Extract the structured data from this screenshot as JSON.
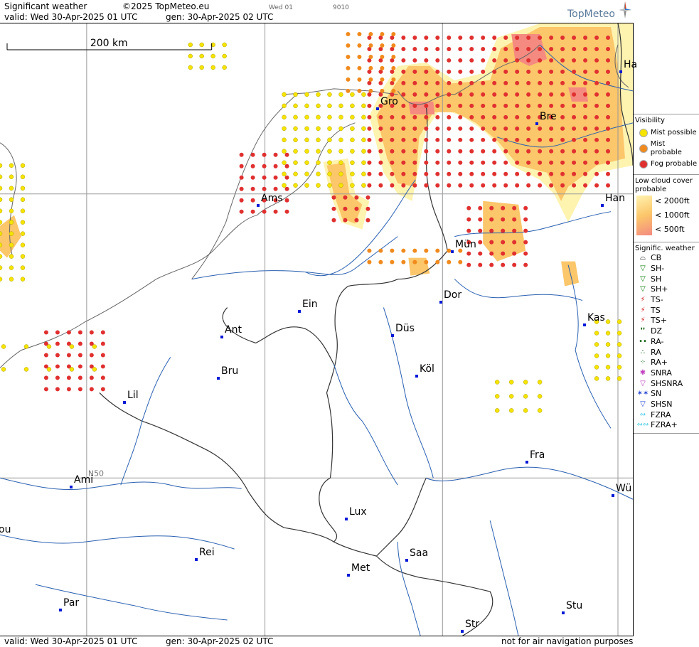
{
  "header": {
    "title": "Significant weather",
    "copyright": "©2025 TopMeteo.eu",
    "valid": "valid:  Wed  30-Apr-2025  01 UTC",
    "generated": "gen:  30-Apr-2025  02 UTC",
    "small_day": "Wed 01",
    "small_code": "9010",
    "brand": "TopMeteo"
  },
  "map": {
    "scale_label": "200 km",
    "grid_label": "N50",
    "cities": [
      {
        "label": "Gro"
      },
      {
        "label": "Bre"
      },
      {
        "label": "Ha"
      },
      {
        "label": "Ams"
      },
      {
        "label": "Han"
      },
      {
        "label": "Mün"
      },
      {
        "label": "Dor"
      },
      {
        "label": "Ein"
      },
      {
        "label": "Ant"
      },
      {
        "label": "Düs"
      },
      {
        "label": "Kas"
      },
      {
        "label": "Bru"
      },
      {
        "label": "Köl"
      },
      {
        "label": "Lil"
      },
      {
        "label": "Fra"
      },
      {
        "label": "Ami"
      },
      {
        "label": "Wü"
      },
      {
        "label": "Lux"
      },
      {
        "label": "ou"
      },
      {
        "label": "Rei"
      },
      {
        "label": "Saa"
      },
      {
        "label": "Met"
      },
      {
        "label": "Par"
      },
      {
        "label": "Stu"
      },
      {
        "label": "Str"
      }
    ]
  },
  "legend": {
    "visibility_title": "Visibility",
    "visibility": [
      {
        "label": "Mist possible",
        "color": "#f5e400"
      },
      {
        "label": "Mist probable",
        "color": "#f08a1c"
      },
      {
        "label": "Fog probable",
        "color": "#e03030"
      }
    ],
    "cloud_title": "Low cloud cover probable",
    "cloud": [
      {
        "label": "< 2000ft",
        "color": "#fff3b0"
      },
      {
        "label": "< 1000ft",
        "color": "#fcc66a"
      },
      {
        "label": "<   500ft",
        "color": "#f48a80"
      }
    ],
    "wx_title": "Signific. weather",
    "wx": [
      {
        "label": "CB",
        "icon": "cb-icon",
        "color": "#000000"
      },
      {
        "label": "SH-",
        "icon": "shower-light-icon",
        "color": "#0a7a0a"
      },
      {
        "label": "SH",
        "icon": "shower-icon",
        "color": "#0a7a0a"
      },
      {
        "label": "SH+",
        "icon": "shower-heavy-icon",
        "color": "#0a7a0a"
      },
      {
        "label": "TS-",
        "icon": "thunder-light-icon",
        "color": "#d02020"
      },
      {
        "label": "TS",
        "icon": "thunder-icon",
        "color": "#d02020"
      },
      {
        "label": "TS+",
        "icon": "thunder-heavy-icon",
        "color": "#d02020"
      },
      {
        "label": "DZ",
        "icon": "drizzle-icon",
        "color": "#0a5a0a"
      },
      {
        "label": "RA-",
        "icon": "rain-light-icon",
        "color": "#0a5a0a"
      },
      {
        "label": "RA",
        "icon": "rain-icon",
        "color": "#0a5a0a"
      },
      {
        "label": "RA+",
        "icon": "rain-heavy-icon",
        "color": "#0a5a0a"
      },
      {
        "label": "SNRA",
        "icon": "sleet-icon",
        "color": "#c040c0"
      },
      {
        "label": "SHSNRA",
        "icon": "sleet-shower-icon",
        "color": "#c040c0"
      },
      {
        "label": "SN",
        "icon": "snow-icon",
        "color": "#2040d0"
      },
      {
        "label": "SHSN",
        "icon": "snow-shower-icon",
        "color": "#2040d0"
      },
      {
        "label": "FZRA",
        "icon": "freezing-rain-icon",
        "color": "#20c0e0"
      },
      {
        "label": "FZRA+",
        "icon": "freezing-rain-heavy-icon",
        "color": "#20c0e0"
      }
    ]
  },
  "footer": {
    "valid": "valid:  Wed  30-Apr-2025  01 UTC",
    "generated": "gen:  30-Apr-2025  02 UTC",
    "disclaimer": "not for air navigation purposes"
  }
}
